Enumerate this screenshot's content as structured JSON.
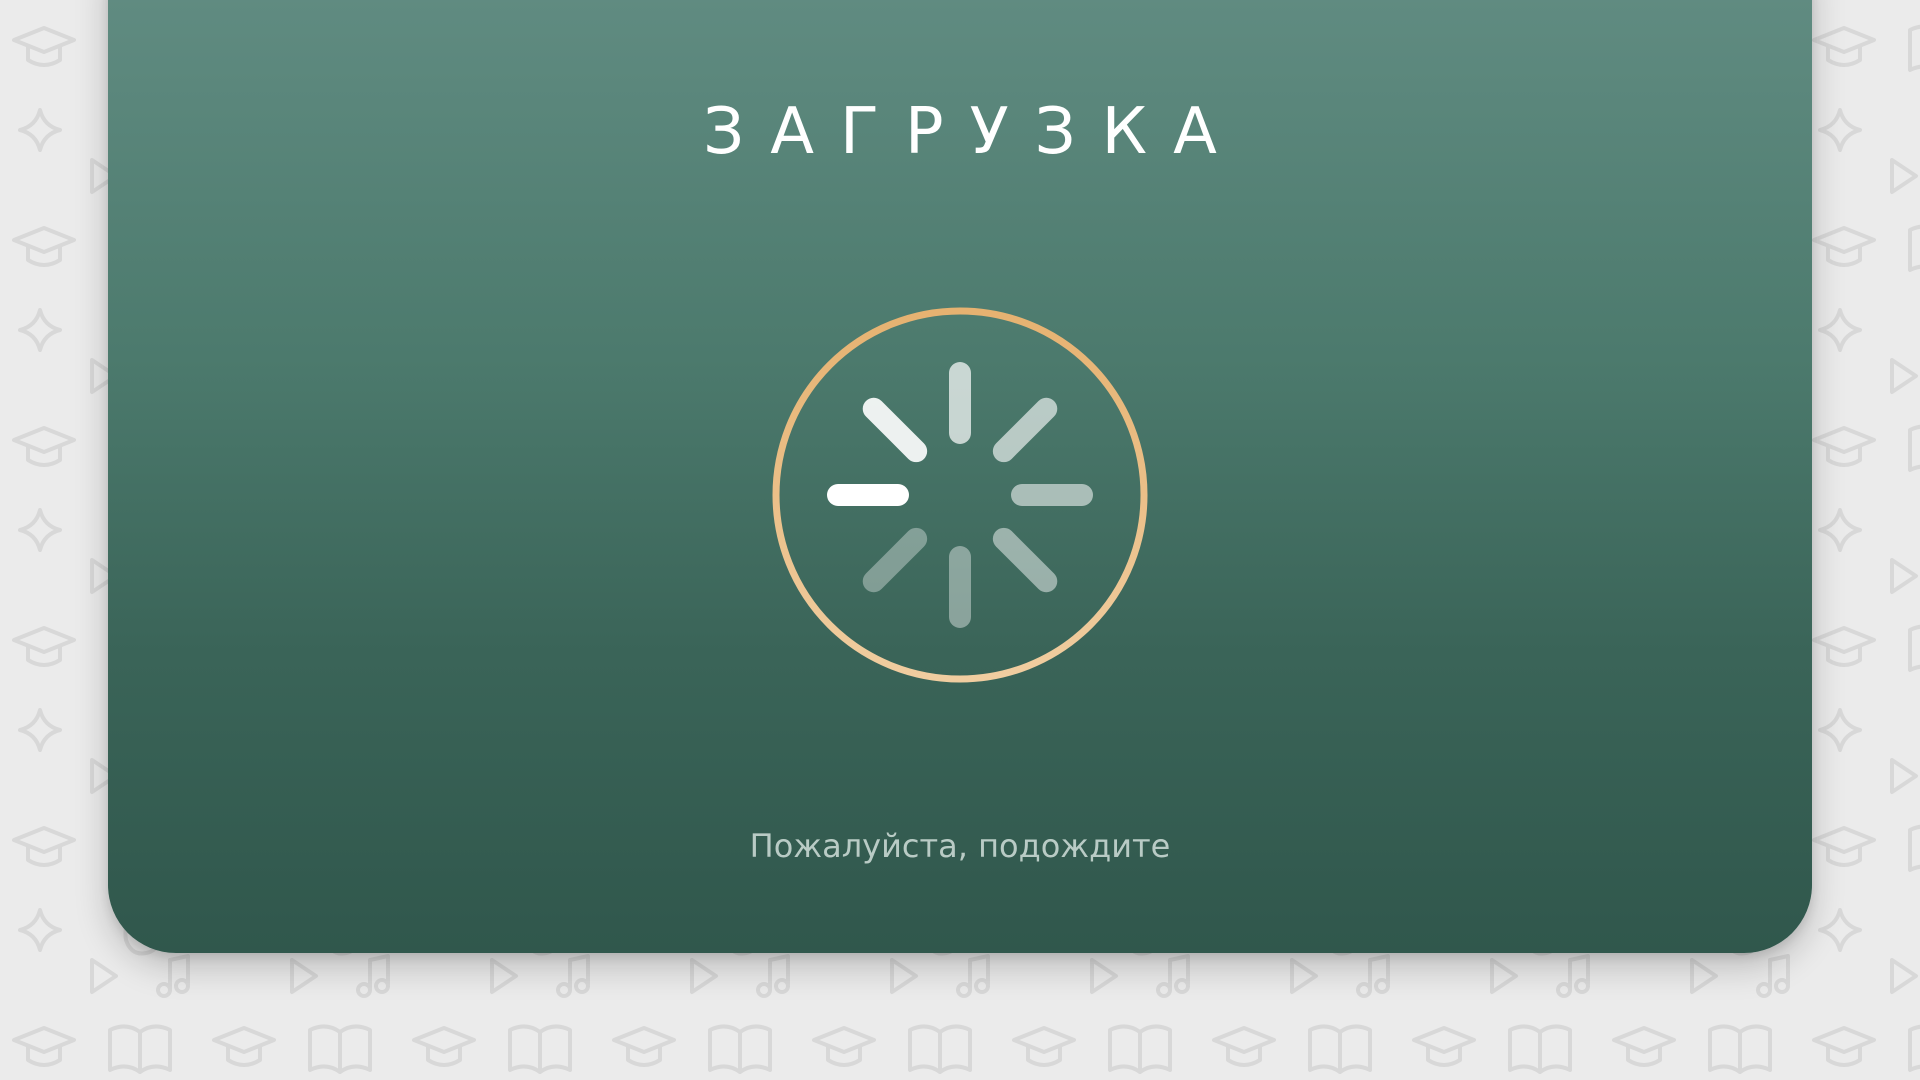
{
  "loading_screen": {
    "title": "ЗАГРУЗКА",
    "subtitle": "Пожалуйста, подождите"
  },
  "spinner": {
    "ring_gradient": [
      "#e6b271",
      "#f0cda0"
    ],
    "spoke_color": "#ffffff",
    "spoke_opacities": [
      0.7,
      0.62,
      0.55,
      0.48,
      0.4,
      0.35,
      1.0,
      0.9
    ]
  },
  "colors": {
    "background": "#ebebeb",
    "card_top": "#628d83",
    "card_bottom": "#30574c",
    "subtitle": "#b9cbc5"
  }
}
